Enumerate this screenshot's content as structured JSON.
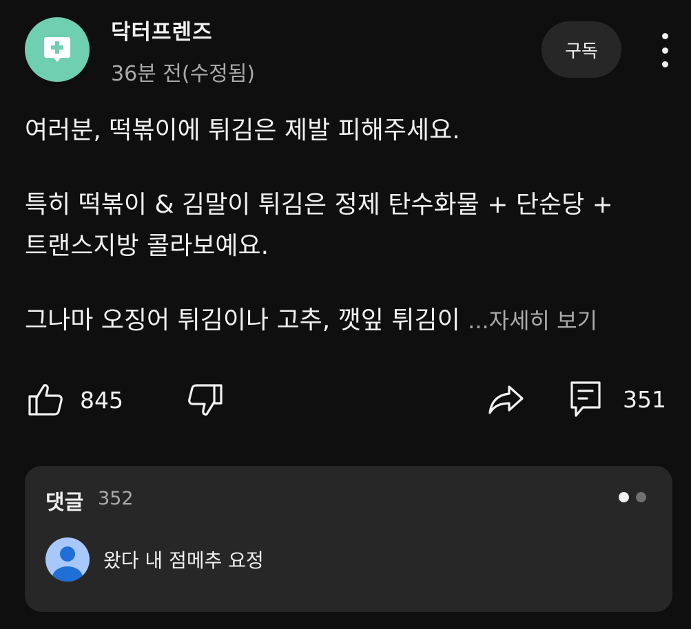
{
  "header": {
    "channel_name": "닥터프렌즈",
    "post_time": "36분 전(수정됨)",
    "subscribe_label": "구독",
    "avatar_icon": "medical-cross-icon",
    "avatar_color": "#6fcfb0"
  },
  "post": {
    "line1": "여러분, 떡볶이에 튀김은 제발 피해주세요.",
    "line2": "특히 떡볶이 & 김말이 튀김은 정제 탄수화물 + 단순당 +",
    "line3": "트랜스지방 콜라보예요.",
    "line4": "그나마 오징어 튀김이나 고추, 깻잎 튀김이 ",
    "read_more": "...자세히 보기"
  },
  "actions": {
    "like_count": "845",
    "comment_count": "351",
    "icons": [
      "thumbs-up-icon",
      "thumbs-down-icon",
      "share-icon",
      "comment-icon"
    ]
  },
  "comments": {
    "title": "댓글",
    "count": "352",
    "top_comment": "왔다 내 점메추 요정",
    "commenter_avatar_color": "#a8c7fa"
  }
}
